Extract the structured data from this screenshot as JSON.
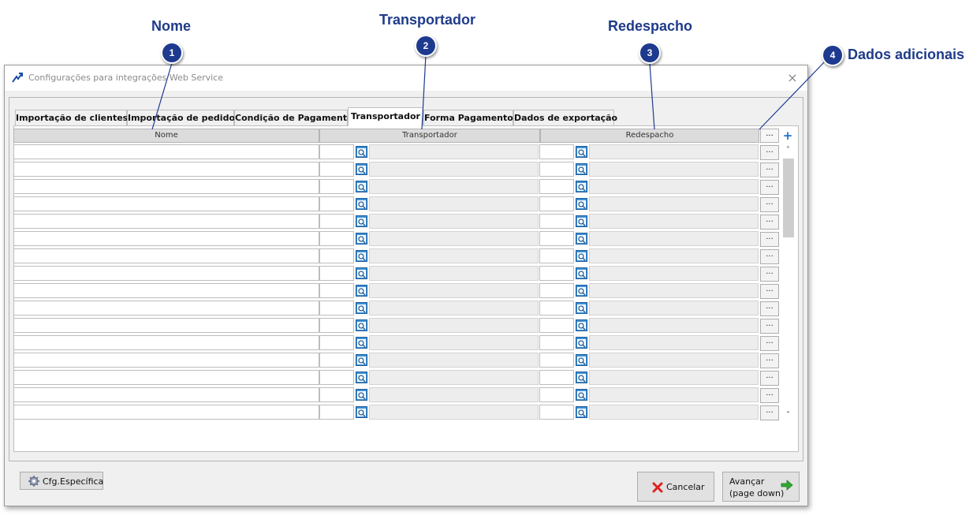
{
  "annotations": [
    {
      "number": "1",
      "title": "Nome"
    },
    {
      "number": "2",
      "title": "Transportador"
    },
    {
      "number": "3",
      "title": "Redespacho"
    },
    {
      "number": "4",
      "title": "Dados adicionais"
    }
  ],
  "window": {
    "title": "Configurações para integrações Web Service",
    "close_icon": "×"
  },
  "tabs": [
    {
      "label": "Importação de clientes"
    },
    {
      "label": "Importação de pedido"
    },
    {
      "label": "Condição de Pagamento"
    },
    {
      "label": "Transportador",
      "active": true
    },
    {
      "label": "Forma Pagamento"
    },
    {
      "label": "Dados de exportação"
    }
  ],
  "grid": {
    "columns": {
      "nome": "Nome",
      "transportador": "Transportador",
      "redespacho": "Redespacho"
    },
    "header_more": "...",
    "add_icon": "+",
    "row_more": "...",
    "row_count": 16,
    "scroll_up": "˄",
    "scroll_down": "˅"
  },
  "footer": {
    "cfg_label": "Cfg.Específica",
    "cancel_label": "Cancelar",
    "next_line1": "Avançar",
    "next_line2": "(page down)"
  },
  "colors": {
    "annotation_blue": "#1d3a8f",
    "add_icon": "#1b6fd1",
    "cancel_icon": "#e02020",
    "next_arrow": "#2faa2f"
  }
}
